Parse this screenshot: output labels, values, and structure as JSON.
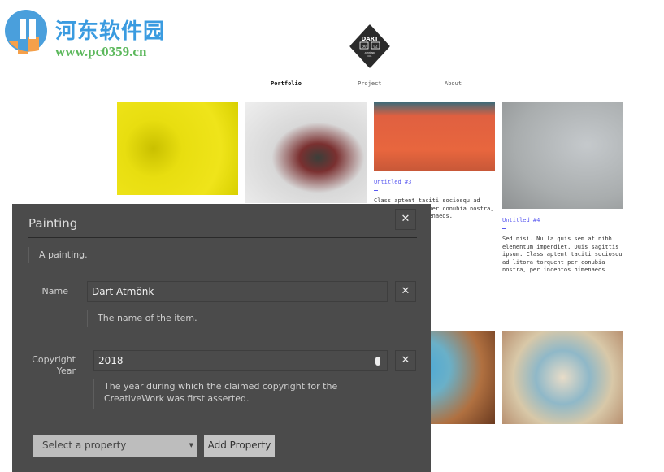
{
  "watermark": {
    "title": "河东软件园",
    "url": "www.pc0359.cn"
  },
  "logo": {
    "line1": "DART",
    "left": "30",
    "right": "02",
    "line2": "ATMÖNK",
    "line3": "CO."
  },
  "nav": [
    {
      "label": "Portfolio",
      "active": true
    },
    {
      "label": "Project",
      "active": false
    },
    {
      "label": "About",
      "active": false
    }
  ],
  "tiles": [
    {
      "title": "",
      "text": ""
    },
    {
      "title": "",
      "text": ""
    },
    {
      "title": "Untitled #3",
      "text": "Class aptent taciti sociosqu ad litora torquent per conubia nostra, per inceptos himenaeos."
    },
    {
      "title": "Untitled #4",
      "text": "Sed nisi. Nulla quis sem at nibh elementum imperdiet. Duis sagittis ipsum. Class aptent taciti sociosqu ad litora torquent per conubia nostra, per inceptos himenaeos."
    }
  ],
  "dialog": {
    "title": "Painting",
    "description": "A painting.",
    "fields": [
      {
        "label": "Name",
        "value": "Dart Atmönk",
        "help": "The name of the item."
      },
      {
        "label": "Copyright Year",
        "value": "2018",
        "help": "The year during which the claimed copyright for the CreativeWork was first asserted."
      }
    ],
    "select_placeholder": "Select a property",
    "add_button": "Add Property",
    "close_symbol": "✕"
  },
  "colors": {
    "dialog_bg": "#4b4b4b",
    "link": "#5a5af0"
  }
}
